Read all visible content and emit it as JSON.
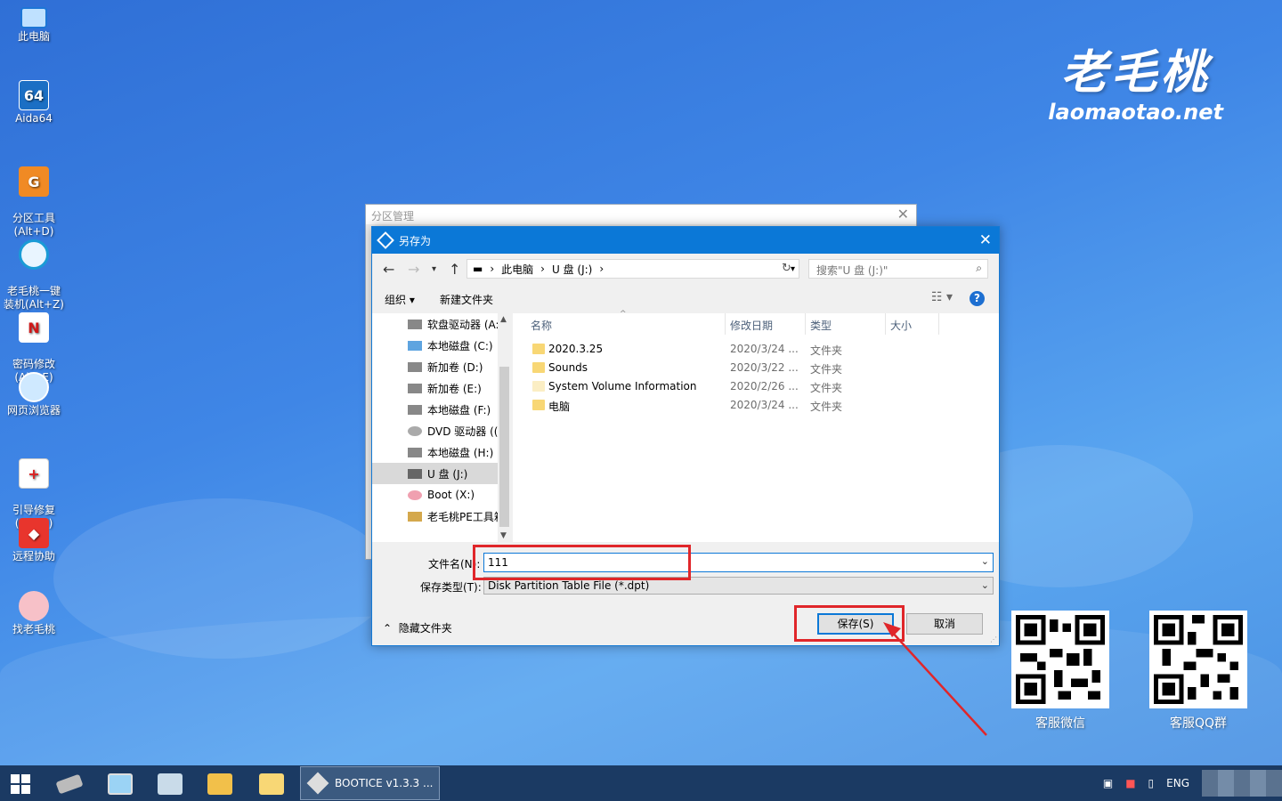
{
  "desktop": {
    "icons": [
      {
        "label": "此电脑"
      },
      {
        "label": "Aida64",
        "glyph": "64"
      },
      {
        "label": "分区工具\n(Alt+D)"
      },
      {
        "label": "老毛桃一键\n装机(Alt+Z)"
      },
      {
        "label": "密码修改\n(Alt+E)"
      },
      {
        "label": "网页浏览器"
      },
      {
        "label": "引导修复\n(Alt+F)"
      },
      {
        "label": "远程协助"
      },
      {
        "label": "找老毛桃"
      }
    ],
    "logo": {
      "cn": "老毛桃",
      "url": "laomaotao.net"
    },
    "qr": [
      {
        "label": "客服微信"
      },
      {
        "label": "客服QQ群"
      }
    ]
  },
  "back_window": {
    "title": "分区管理"
  },
  "dialog": {
    "title": "另存为",
    "breadcrumb": [
      "此电脑",
      "U 盘 (J:)"
    ],
    "search_placeholder": "搜索\"U 盘 (J:)\"",
    "toolbar": {
      "organize": "组织 ▾",
      "new_folder": "新建文件夹",
      "help": "?"
    },
    "tree": [
      {
        "label": "软盘驱动器 (A:"
      },
      {
        "label": "本地磁盘 (C:)"
      },
      {
        "label": "新加卷 (D:)"
      },
      {
        "label": "新加卷 (E:)"
      },
      {
        "label": "本地磁盘 (F:)"
      },
      {
        "label": "DVD 驱动器 (("
      },
      {
        "label": "本地磁盘 (H:)"
      },
      {
        "label": "U 盘 (J:)",
        "selected": true
      },
      {
        "label": "Boot (X:)"
      },
      {
        "label": "老毛桃PE工具箱"
      }
    ],
    "columns": {
      "name": "名称",
      "modified": "修改日期",
      "type": "类型",
      "size": "大小"
    },
    "files": [
      {
        "name": "2020.3.25",
        "modified": "2020/3/24 ...",
        "type": "文件夹"
      },
      {
        "name": "Sounds",
        "modified": "2020/3/22 ...",
        "type": "文件夹"
      },
      {
        "name": "System Volume Information",
        "modified": "2020/2/26 ...",
        "type": "文件夹"
      },
      {
        "name": "电脑",
        "modified": "2020/3/24 ...",
        "type": "文件夹"
      }
    ],
    "filename_label": "文件名(N):",
    "filename_value": "111",
    "filetype_label": "保存类型(T):",
    "filetype_value": "Disk Partition Table File (*.dpt)",
    "hide_folders": "隐藏文件夹",
    "save_button": "保存(S)",
    "cancel_button": "取消"
  },
  "taskbar": {
    "task_label": "BOOTICE v1.3.3 ...",
    "lang": "ENG"
  },
  "colors": {
    "accent": "#0b78d7",
    "highlight": "#e0262a",
    "taskbar": "#1b3a63"
  }
}
